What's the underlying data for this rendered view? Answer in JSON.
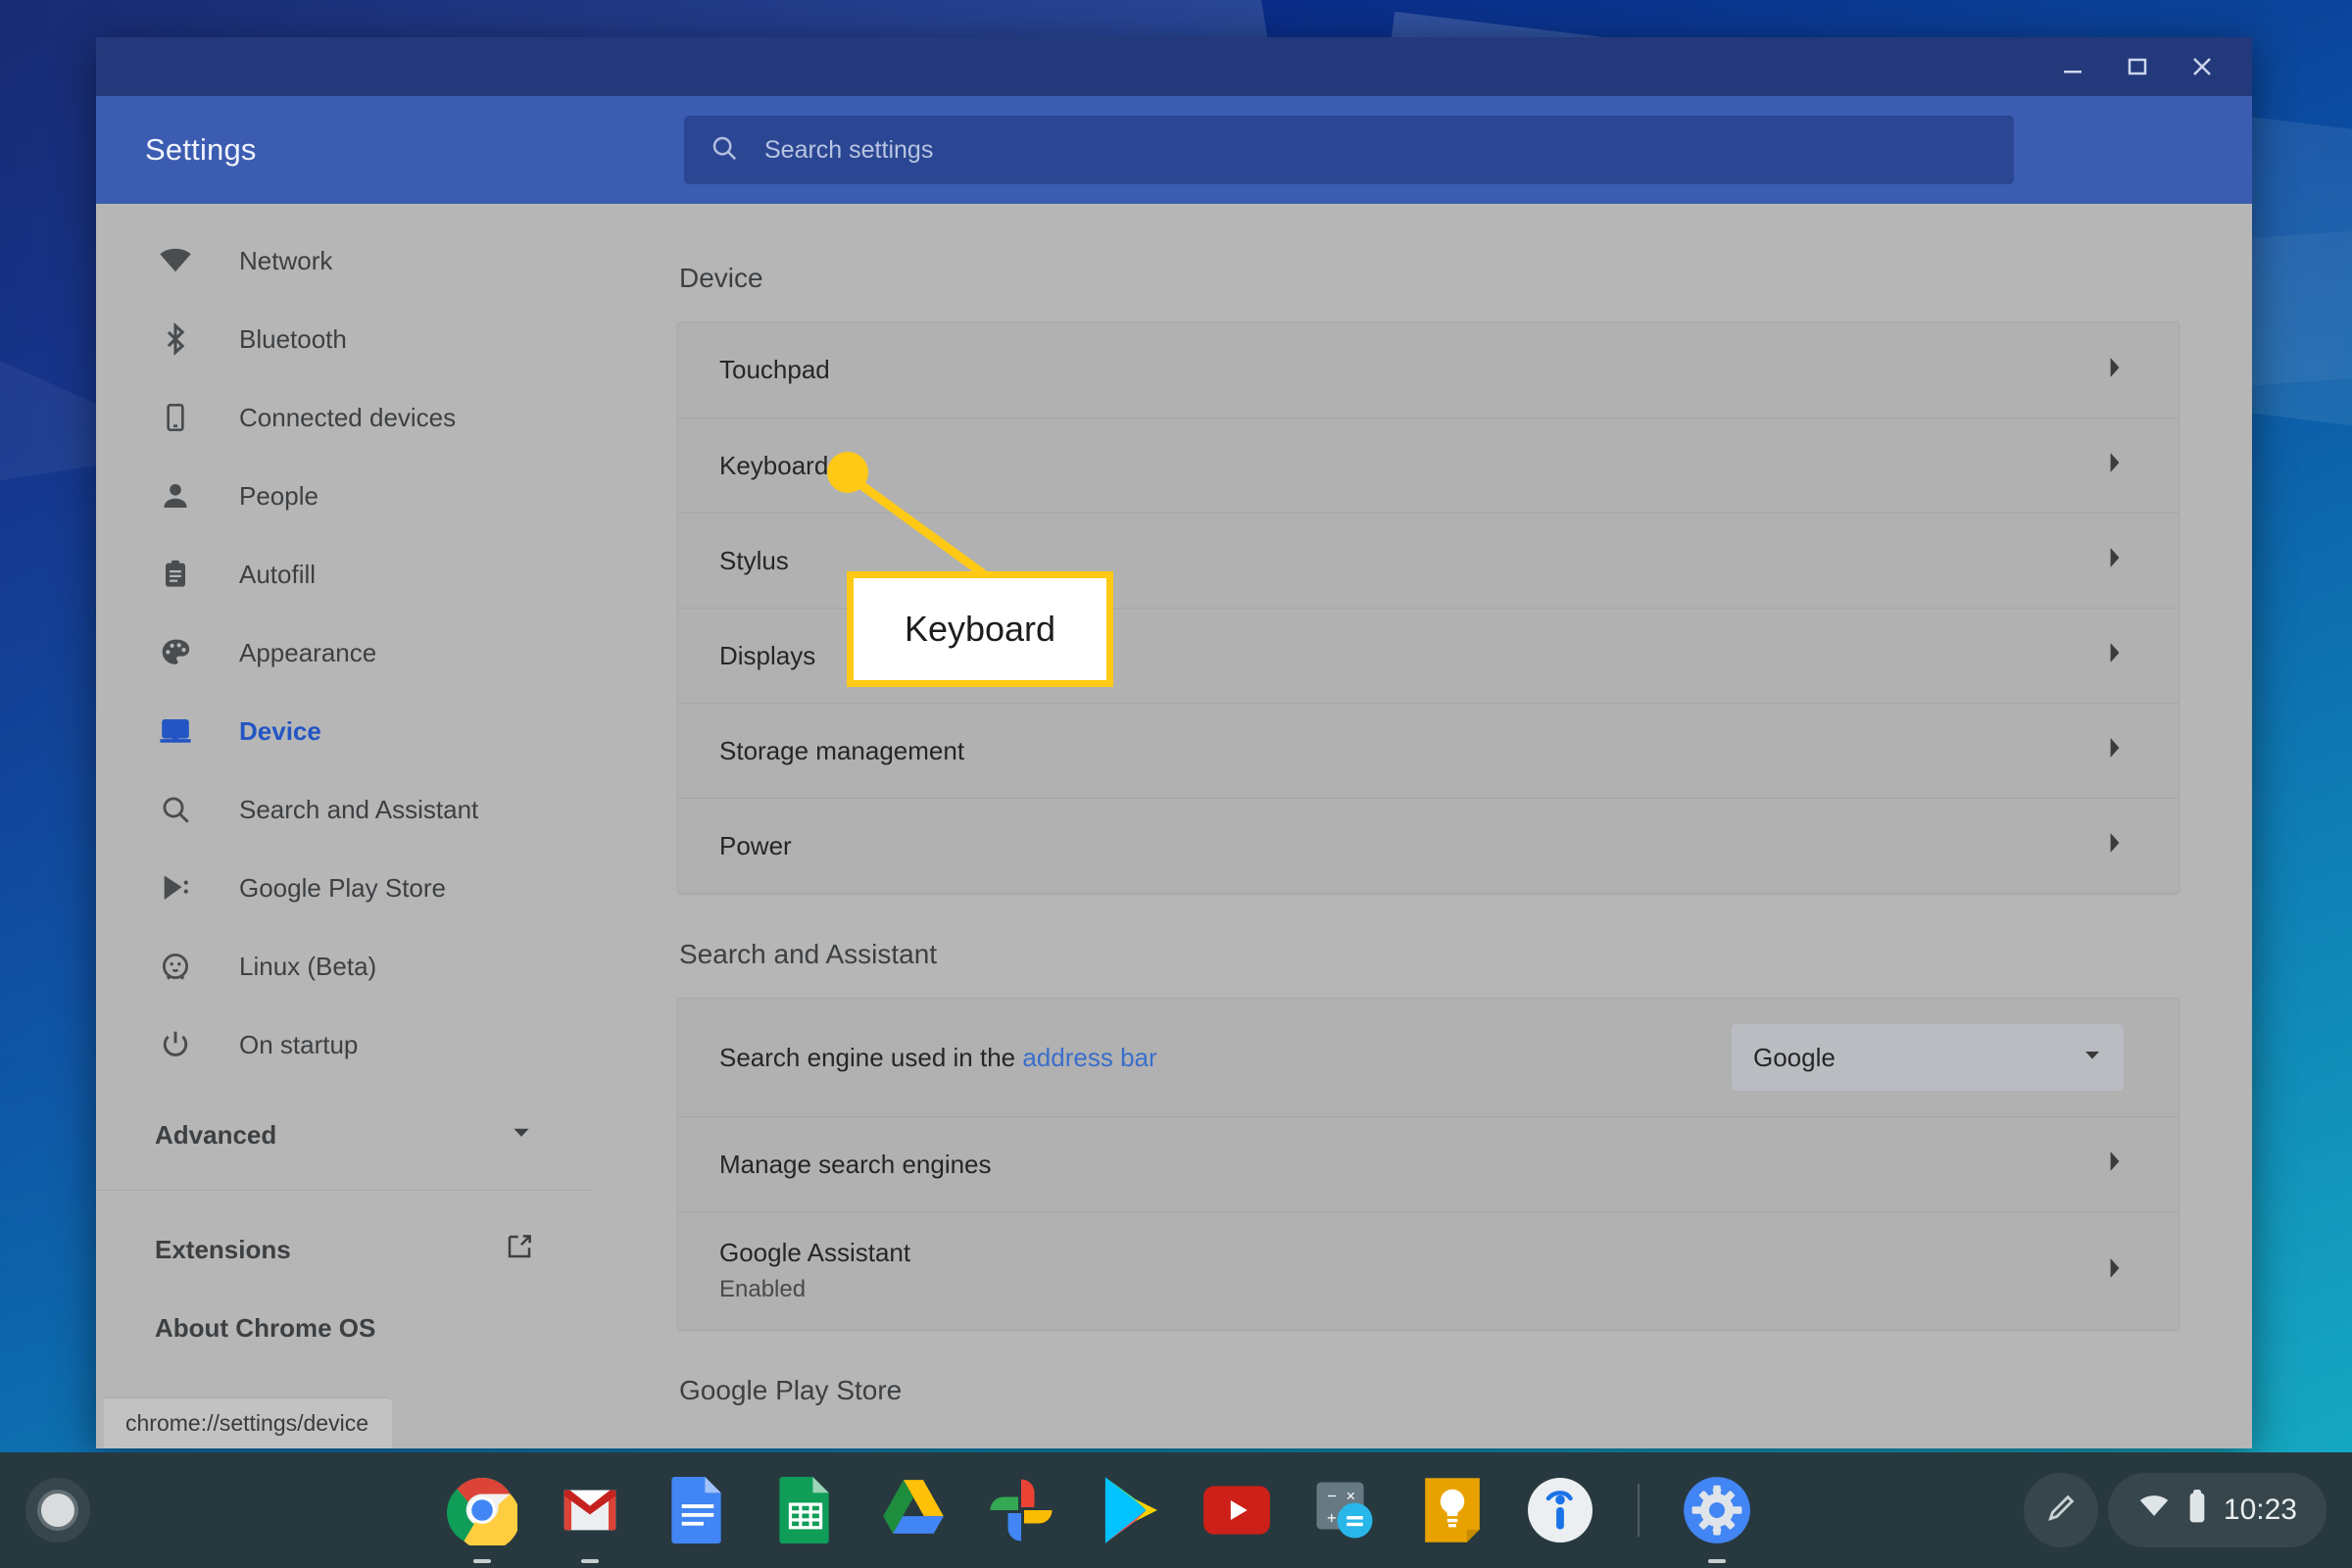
{
  "window": {
    "title": "Settings",
    "controls": {
      "minimize": "minimize-icon",
      "maximize": "maximize-icon",
      "close": "close-icon"
    }
  },
  "search": {
    "placeholder": "Search settings",
    "value": "",
    "icon": "search-icon"
  },
  "sidebar": {
    "items": [
      {
        "label": "Network",
        "icon": "wifi-icon",
        "active": false
      },
      {
        "label": "Bluetooth",
        "icon": "bluetooth-icon",
        "active": false
      },
      {
        "label": "Connected devices",
        "icon": "phone-icon",
        "active": false
      },
      {
        "label": "People",
        "icon": "person-icon",
        "active": false
      },
      {
        "label": "Autofill",
        "icon": "clipboard-icon",
        "active": false
      },
      {
        "label": "Appearance",
        "icon": "palette-icon",
        "active": false
      },
      {
        "label": "Device",
        "icon": "laptop-icon",
        "active": true
      },
      {
        "label": "Search and Assistant",
        "icon": "search-icon",
        "active": false
      },
      {
        "label": "Google Play Store",
        "icon": "play-store-icon",
        "active": false
      },
      {
        "label": "Linux (Beta)",
        "icon": "penguin-icon",
        "active": false
      },
      {
        "label": "On startup",
        "icon": "power-icon",
        "active": false
      }
    ],
    "advanced": {
      "label": "Advanced",
      "icon": "chevron-down-icon"
    },
    "footer": [
      {
        "label": "Extensions",
        "icon": "external-link-icon"
      },
      {
        "label": "About Chrome OS",
        "icon": ""
      }
    ]
  },
  "status_bar": {
    "url": "chrome://settings/device"
  },
  "main": {
    "sections": [
      {
        "title": "Device",
        "rows": [
          {
            "label": "Touchpad",
            "sub": "",
            "control": "chevron-right-icon"
          },
          {
            "label": "Keyboard",
            "sub": "",
            "control": "chevron-right-icon"
          },
          {
            "label": "Stylus",
            "sub": "",
            "control": "chevron-right-icon"
          },
          {
            "label": "Displays",
            "sub": "",
            "control": "chevron-right-icon"
          },
          {
            "label": "Storage management",
            "sub": "",
            "control": "chevron-right-icon"
          },
          {
            "label": "Power",
            "sub": "",
            "control": "chevron-right-icon"
          }
        ]
      },
      {
        "title": "Search and Assistant",
        "rows": [
          {
            "label": "Search engine used in the ",
            "link": "address bar",
            "sub": "",
            "control": "select",
            "select_value": "Google"
          },
          {
            "label": "Manage search engines",
            "sub": "",
            "control": "chevron-right-icon"
          },
          {
            "label": "Google Assistant",
            "sub": "Enabled",
            "control": "chevron-right-icon"
          }
        ]
      },
      {
        "title": "Google Play Store",
        "rows": []
      }
    ]
  },
  "callout": {
    "label": "Keyboard",
    "color": "#FFC915"
  },
  "shelf": {
    "launcher": "launcher-icon",
    "apps": [
      {
        "name": "chrome-icon",
        "running": true
      },
      {
        "name": "gmail-icon",
        "running": true
      },
      {
        "name": "google-docs-icon",
        "running": false
      },
      {
        "name": "google-sheets-icon",
        "running": false
      },
      {
        "name": "google-drive-icon",
        "running": false
      },
      {
        "name": "google-photos-icon",
        "running": false
      },
      {
        "name": "play-store-icon",
        "running": false
      },
      {
        "name": "youtube-icon",
        "running": false
      },
      {
        "name": "calculator-icon",
        "running": false
      },
      {
        "name": "google-keep-icon",
        "running": false
      },
      {
        "name": "info-icon",
        "running": false
      },
      {
        "name": "settings-gear-icon",
        "running": true
      }
    ],
    "stylus_button": "stylus-icon",
    "tray": {
      "wifi": "wifi-icon",
      "battery": "battery-icon",
      "time": "10:23"
    }
  },
  "colors": {
    "accent": "#2355c4",
    "titlebar": "#23397b",
    "appbar": "#3b5cb0",
    "callout": "#FFC915",
    "link": "#3a6ecb"
  }
}
